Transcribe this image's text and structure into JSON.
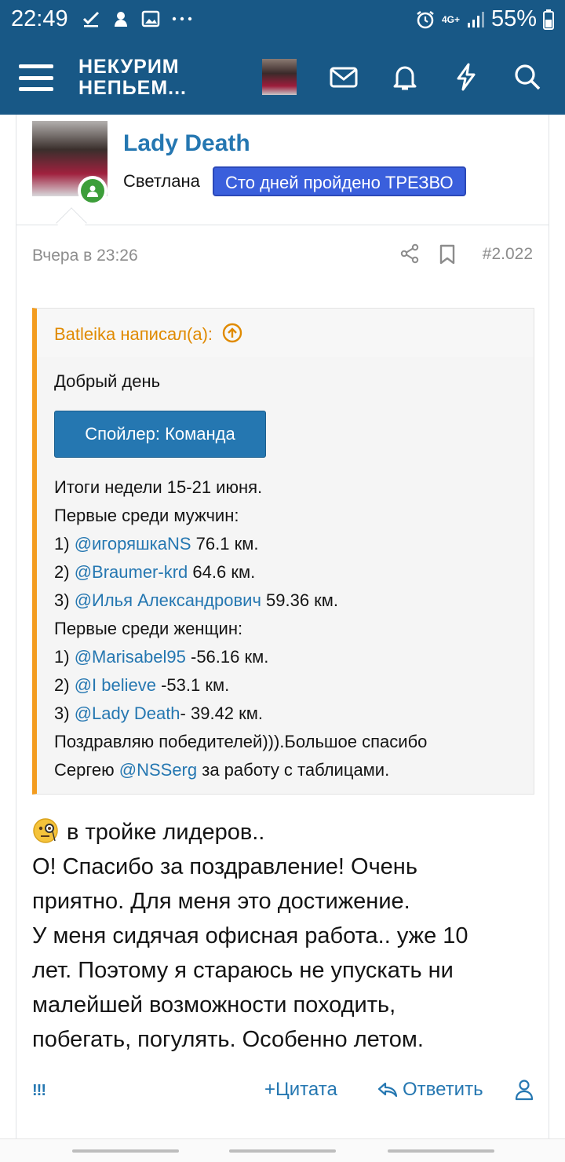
{
  "status_bar": {
    "time": "22:49",
    "left_icons": [
      "check-icon",
      "app-icon",
      "image-icon",
      "more-icon"
    ],
    "network": "4G+",
    "battery": "55%"
  },
  "header": {
    "logo_line1": "НЕКУРИМ",
    "logo_line2": "НЕПЬЕМ...",
    "icons": [
      "avatar",
      "mail-icon",
      "bell-icon",
      "bolt-icon",
      "search-icon"
    ]
  },
  "post": {
    "username": "Lady Death",
    "user_title": "Светлана",
    "banner": "Сто дней пройдено ТРЕЗВО",
    "date": "Вчера в 23:26",
    "post_number": "#2.022",
    "quote": {
      "author": "Batleika написал(а):",
      "greeting": "Добрый день",
      "spoiler_label": "Спойлер: Команда",
      "l1": "Итоги недели 15-21 июня.",
      "l2": "Первые среди мужчин:",
      "l3_pre": "1) ",
      "l3_mention": "@игоряшкаNS",
      "l3_post": " 76.1 км.",
      "l4_pre": "2) ",
      "l4_mention": "@Braumer-krd",
      "l4_post": " 64.6 км.",
      "l5_pre": "3) ",
      "l5_mention": "@Илья Александрович",
      "l5_post": " 59.36 км.",
      "l6": "Первые среди женщин:",
      "l7_pre": "1) ",
      "l7_mention": "@Marisabel95",
      "l7_post": " -56.16 км.",
      "l8_pre": "2) ",
      "l8_mention": "@I believe",
      "l8_post": " -53.1 км.",
      "l9_pre": "3) ",
      "l9_mention": "@Lady Death",
      "l9_post": "- 39.42 км.",
      "l10": "Поздравляю победителей))).Большое спасибо",
      "l11_pre": "Сергею ",
      "l11_mention": "@NSSerg",
      "l11_post": " за работу с таблицами."
    },
    "body": {
      "line1": "в тройке лидеров..",
      "line2": "О! Спасибо за поздравление! Очень",
      "line3": "приятно. Для меня это достижение.",
      "line4": "У меня сидячая офисная работа.. уже 10",
      "line5": "лет. Поэтому я стараюсь не упускать ни",
      "line6": "малейшей возможности походить,",
      "line7": "побегать, погулять. Особенно летом."
    },
    "actions": {
      "react": "!!!",
      "quote": "Цитата",
      "reply": "Ответить"
    }
  },
  "colors": {
    "header_bg": "#185886",
    "link": "#2577b1",
    "quote_accent": "#f39c1f",
    "banner_bg": "#3a5fdc",
    "online": "#3d9e3a"
  }
}
